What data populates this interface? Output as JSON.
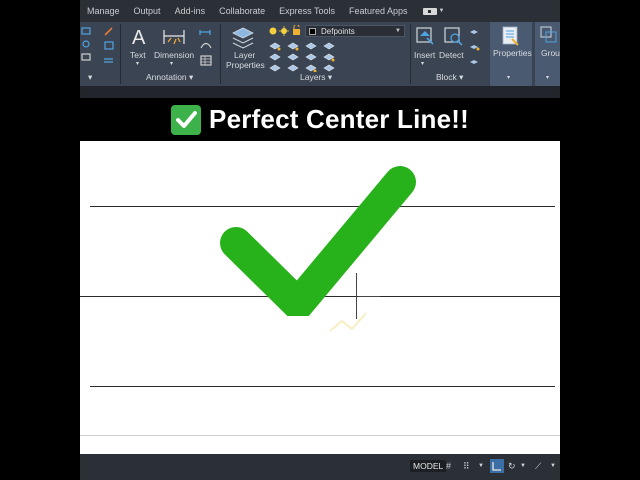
{
  "ribbon": {
    "tabs": [
      "Manage",
      "Output",
      "Add-ins",
      "Collaborate",
      "Express Tools",
      "Featured Apps"
    ],
    "panels": {
      "annotation": {
        "label": "Annotation",
        "text_tool": "Text",
        "dimension_tool": "Dimension"
      },
      "layers": {
        "label": "Layers",
        "layer_properties_line1": "Layer",
        "layer_properties_line2": "Properties",
        "current_layer": "Defpoints"
      },
      "block": {
        "label": "Block",
        "insert": "Insert",
        "detect": "Detect"
      },
      "properties": {
        "label": "Properties"
      },
      "groups": {
        "label": "Grou"
      }
    }
  },
  "overlay": {
    "title": "Perfect Center Line!!",
    "check_color": "#27b11b"
  },
  "statusbar": {
    "model_label": "MODEL"
  },
  "colors": {
    "ribbon_bg": "#3b4452",
    "canvas_bg": "#ffffff",
    "line_color": "#2b2b2b"
  }
}
